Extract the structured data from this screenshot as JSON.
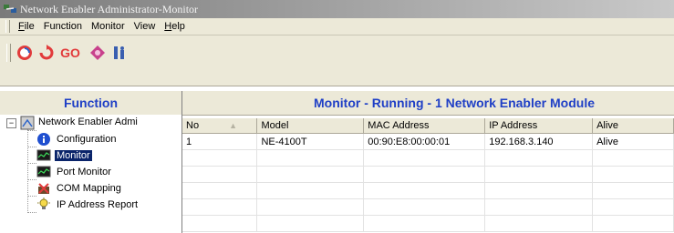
{
  "window": {
    "title": "Network Enabler Administrator-Monitor"
  },
  "menu": [
    {
      "prefix": "",
      "mnemonic": "F",
      "rest": "ile"
    },
    {
      "prefix": "Function",
      "mnemonic": "",
      "rest": ""
    },
    {
      "prefix": "Monitor",
      "mnemonic": "",
      "rest": ""
    },
    {
      "prefix": "View",
      "mnemonic": "",
      "rest": ""
    },
    {
      "prefix": "",
      "mnemonic": "H",
      "rest": "elp"
    }
  ],
  "toolbar": {
    "icons": [
      "start-monitor-icon",
      "refresh-icon",
      "go-icon",
      "settings-icon",
      "exit-icon"
    ],
    "go_label": "GO"
  },
  "left_panel": {
    "header": "Function",
    "tree": {
      "root": "Network Enabler Admi",
      "items": [
        {
          "label": "Configuration",
          "icon": "info-icon"
        },
        {
          "label": "Monitor",
          "icon": "monitor-icon"
        },
        {
          "label": "Port Monitor",
          "icon": "monitor-icon"
        },
        {
          "label": "COM Mapping",
          "icon": "com-mapping-icon"
        },
        {
          "label": "IP Address Report",
          "icon": "bulb-icon"
        }
      ],
      "selected": "Monitor"
    }
  },
  "right_panel": {
    "header": "Monitor - Running - 1 Network Enabler Module",
    "columns": [
      "No",
      "Model",
      "MAC Address",
      "IP Address",
      "Alive"
    ],
    "rows": [
      [
        "1",
        "NE-4100T",
        "00:90:E8:00:00:01",
        "192.168.3.140",
        "Alive"
      ]
    ]
  },
  "colors": {
    "header_text": "#1f3fc6",
    "selection": "#0a246a",
    "chrome": "#ece9d8"
  }
}
